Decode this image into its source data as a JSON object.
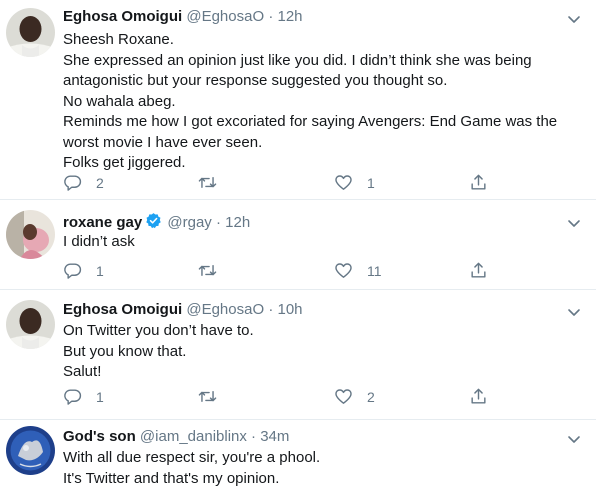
{
  "tweets": [
    {
      "name": "Eghosa Omoigui",
      "handle": "@EghosaO",
      "time": "12h",
      "lines": [
        "Sheesh Roxane.",
        "She expressed an opinion just like you did. I didn’t think she was being",
        "antagonistic but your response suggested you thought so.",
        "No wahala abeg.",
        "Reminds me how I got excoriated for saying Avengers: End Game was the",
        "worst movie I have ever seen.",
        "Folks get jiggered."
      ],
      "replies": "2",
      "retweets": "",
      "likes": "1"
    },
    {
      "name": "roxane gay",
      "handle": "@rgay",
      "time": "12h",
      "verified": true,
      "lines": [
        "I didn’t ask"
      ],
      "replies": "1",
      "retweets": "",
      "likes": "11"
    },
    {
      "name": "Eghosa Omoigui",
      "handle": "@EghosaO",
      "time": "10h",
      "lines": [
        "On Twitter you don’t have to.",
        "But you know that.",
        "Salut!"
      ],
      "replies": "1",
      "retweets": "",
      "likes": "2"
    },
    {
      "name": "God's son",
      "handle": "@iam_daniblinx",
      "time": "34m",
      "lines": [
        "With all due respect sir, you're a phool.",
        "It's Twitter and that's my opinion."
      ]
    }
  ],
  "separator": "·",
  "colors": {
    "name": "#14171a",
    "meta": "#657786",
    "verified": "#1da1f2",
    "divider": "#e6ecf0"
  },
  "icons": [
    "reply-icon",
    "retweet-icon",
    "like-icon",
    "share-icon",
    "chevron-down-icon",
    "verified-badge-icon"
  ]
}
